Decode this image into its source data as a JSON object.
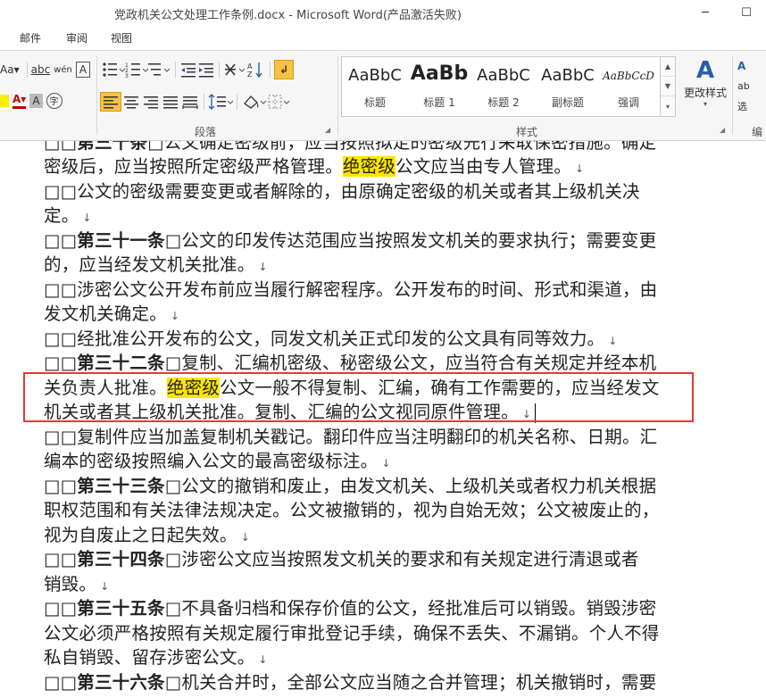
{
  "window": {
    "title": "党政机关公文处理工作条例.docx  -  Microsoft Word(产品激活失败)",
    "minimize": "─",
    "maximize": "☐"
  },
  "menu": {
    "tabs": [
      "邮件",
      "审阅",
      "视图"
    ]
  },
  "ribbon": {
    "groups": {
      "paragraph": "段落",
      "styles": "样式",
      "editing": "编辑"
    },
    "font_row1": [
      "Aa▾",
      "abc",
      "wén",
      "A"
    ],
    "font_row2": [
      "A▾",
      "A",
      "字"
    ],
    "styles": [
      {
        "sample": "AaBbC",
        "name": "标题"
      },
      {
        "sample": "AaBb",
        "name": "标题 1"
      },
      {
        "sample": "AaBbC",
        "name": "标题 2"
      },
      {
        "sample": "AaBbC",
        "name": "副标题"
      },
      {
        "sample": "AaBbCcD",
        "name": "强调"
      }
    ],
    "change_styles": {
      "icon": "A",
      "label": "更改样式"
    },
    "editing_items": [
      "A",
      "ab",
      "选"
    ],
    "accent": "#2a5caa",
    "selected_color": "#f5c242"
  },
  "document": {
    "highlight_color": "#ffe500",
    "selection_box_color": "#e53935",
    "para_mark": "↓",
    "paragraphs": [
      {
        "lines": [
          [
            {
              "t": "□□"
            },
            {
              "t": "第三十条",
              "b": true
            },
            {
              "t": "□公文确定密级前，应当按照拟定的密级先行采取保密措施。确定"
            }
          ],
          [
            {
              "t": "密级后，应当按照所定密级严格管理。"
            },
            {
              "t": "绝密级",
              "h": true
            },
            {
              "t": "公文应当由专人管理。"
            }
          ]
        ]
      },
      {
        "lines": [
          [
            {
              "t": "□□公文的密级需要变更或者解除的，由原确定密级的机关或者其上级机关决"
            }
          ],
          [
            {
              "t": "定。"
            }
          ]
        ]
      },
      {
        "lines": [
          [
            {
              "t": "□□"
            },
            {
              "t": "第三十一条",
              "b": true
            },
            {
              "t": "□公文的印发传达范围应当按照发文机关的要求执行；需要变更"
            }
          ],
          [
            {
              "t": "的，应当经发文机关批准。"
            }
          ]
        ]
      },
      {
        "lines": [
          [
            {
              "t": "□□涉密公文公开发布前应当履行解密程序。公开发布的时间、形式和渠道，由"
            }
          ],
          [
            {
              "t": "发文机关确定。"
            }
          ]
        ]
      },
      {
        "lines": [
          [
            {
              "t": "□□经批准公开发布的公文，同发文机关正式印发的公文具有同等效力。"
            }
          ]
        ]
      },
      {
        "lines": [
          [
            {
              "t": "□□"
            },
            {
              "t": "第三十二条",
              "b": true
            },
            {
              "t": "□复制、汇编机密级、秘密级公文，应当符合有关规定并经本机"
            }
          ],
          [
            {
              "t": "关负责人批准。"
            },
            {
              "t": "绝密级",
              "h": true
            },
            {
              "t": "公文一般不得复制、汇编，确有工作需要的，应当经发文"
            }
          ],
          [
            {
              "t": "机关或者其上级机关批准。复制、汇编的公文视同原件管理。"
            }
          ]
        ]
      },
      {
        "lines": [
          [
            {
              "t": "□□复制件应当加盖复制机关戳记。翻印件应当注明翻印的机关名称、日期。汇"
            }
          ],
          [
            {
              "t": "编本的密级按照编入公文的最高密级标注。"
            }
          ]
        ]
      },
      {
        "lines": [
          [
            {
              "t": "□□"
            },
            {
              "t": "第三十三条",
              "b": true
            },
            {
              "t": "□公文的撤销和废止，由发文机关、上级机关或者权力机关根据"
            }
          ],
          [
            {
              "t": "职权范围和有关法律法规决定。公文被撤销的，视为自始无效；公文被废止的，"
            }
          ],
          [
            {
              "t": "视为自废止之日起失效。"
            }
          ]
        ]
      },
      {
        "lines": [
          [
            {
              "t": "□□"
            },
            {
              "t": "第三十四条",
              "b": true
            },
            {
              "t": "□涉密公文应当按照发文机关的要求和有关规定进行清退或者"
            }
          ],
          [
            {
              "t": "销毁。"
            }
          ]
        ]
      },
      {
        "lines": [
          [
            {
              "t": "□□"
            },
            {
              "t": "第三十五条",
              "b": true
            },
            {
              "t": "□不具备归档和保存价值的公文，经批准后可以销毁。销毁涉密"
            }
          ],
          [
            {
              "t": "公文必须严格按照有关规定履行审批登记手续，确保不丢失、不漏销。个人不得"
            }
          ],
          [
            {
              "t": "私自销毁、留存涉密公文。"
            }
          ]
        ]
      },
      {
        "lines": [
          [
            {
              "t": "□□"
            },
            {
              "t": "第三十六条",
              "b": true
            },
            {
              "t": "□机关合并时，全部公文应当随之合并管理；机关撤销时，需要"
            }
          ]
        ]
      }
    ]
  }
}
